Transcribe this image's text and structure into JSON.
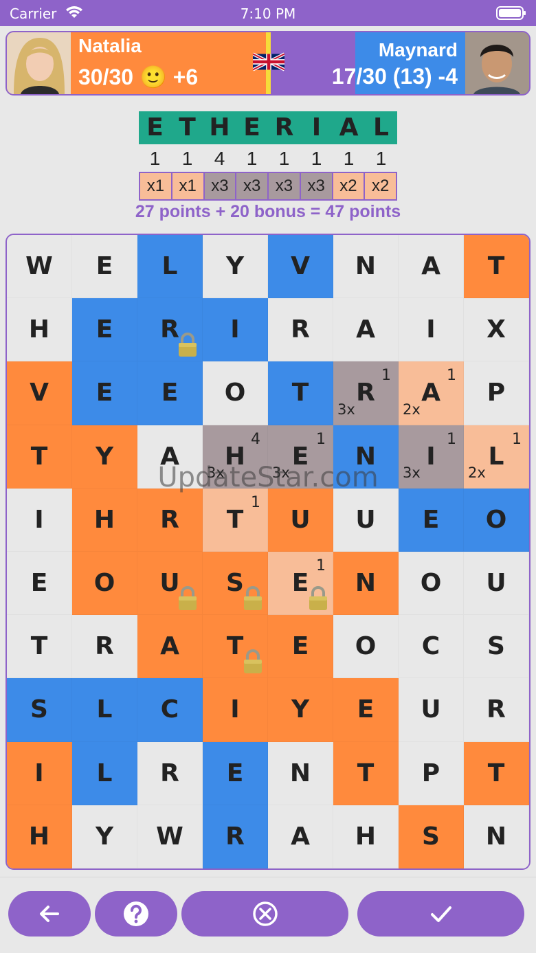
{
  "status": {
    "carrier": "Carrier",
    "time": "7:10 PM"
  },
  "players": {
    "left": {
      "name": "Natalia",
      "score": "30/30 🙂 +6",
      "color": "#ff8a3d"
    },
    "right": {
      "name": "Maynard",
      "score": "17/30 (13) -4",
      "color": "#3d8be8"
    }
  },
  "word": {
    "letters": [
      "E",
      "T",
      "H",
      "E",
      "R",
      "I",
      "A",
      "L"
    ],
    "points": [
      "1",
      "1",
      "4",
      "1",
      "1",
      "1",
      "1",
      "1"
    ],
    "multipliers": [
      "x1",
      "x1",
      "x3",
      "x3",
      "x3",
      "x3",
      "x2",
      "x2"
    ],
    "summary": "27 points + 20 bonus = 47 points"
  },
  "watermark": "UpdateStar.com",
  "board": {
    "rows": [
      [
        {
          "l": "W",
          "c": "n"
        },
        {
          "l": "E",
          "c": "n"
        },
        {
          "l": "L",
          "c": "b"
        },
        {
          "l": "Y",
          "c": "n"
        },
        {
          "l": "V",
          "c": "b"
        },
        {
          "l": "N",
          "c": "n"
        },
        {
          "l": "A",
          "c": "n"
        },
        {
          "l": "T",
          "c": "o"
        }
      ],
      [
        {
          "l": "H",
          "c": "n"
        },
        {
          "l": "E",
          "c": "b"
        },
        {
          "l": "R",
          "c": "b",
          "lock": true
        },
        {
          "l": "I",
          "c": "b"
        },
        {
          "l": "R",
          "c": "n"
        },
        {
          "l": "A",
          "c": "n"
        },
        {
          "l": "I",
          "c": "n"
        },
        {
          "l": "X",
          "c": "n"
        }
      ],
      [
        {
          "l": "V",
          "c": "o"
        },
        {
          "l": "E",
          "c": "b"
        },
        {
          "l": "E",
          "c": "b"
        },
        {
          "l": "O",
          "c": "n"
        },
        {
          "l": "T",
          "c": "b"
        },
        {
          "l": "R",
          "c": "g",
          "pt": "1",
          "mu": "3x"
        },
        {
          "l": "A",
          "c": "p",
          "pt": "1",
          "mu": "2x"
        },
        {
          "l": "P",
          "c": "n"
        }
      ],
      [
        {
          "l": "T",
          "c": "o"
        },
        {
          "l": "Y",
          "c": "o"
        },
        {
          "l": "A",
          "c": "n"
        },
        {
          "l": "H",
          "c": "g",
          "pt": "4",
          "mu": "3x"
        },
        {
          "l": "E",
          "c": "g",
          "pt": "1",
          "mu": "3x"
        },
        {
          "l": "N",
          "c": "b"
        },
        {
          "l": "I",
          "c": "g",
          "pt": "1",
          "mu": "3x"
        },
        {
          "l": "L",
          "c": "p",
          "pt": "1",
          "mu": "2x"
        }
      ],
      [
        {
          "l": "I",
          "c": "n"
        },
        {
          "l": "H",
          "c": "o"
        },
        {
          "l": "R",
          "c": "o"
        },
        {
          "l": "T",
          "c": "p",
          "pt": "1"
        },
        {
          "l": "U",
          "c": "o"
        },
        {
          "l": "U",
          "c": "n"
        },
        {
          "l": "E",
          "c": "b"
        },
        {
          "l": "O",
          "c": "b"
        }
      ],
      [
        {
          "l": "E",
          "c": "n"
        },
        {
          "l": "O",
          "c": "o"
        },
        {
          "l": "U",
          "c": "o",
          "lock": true
        },
        {
          "l": "S",
          "c": "o",
          "lock": true
        },
        {
          "l": "E",
          "c": "p",
          "pt": "1",
          "lock": true
        },
        {
          "l": "N",
          "c": "o"
        },
        {
          "l": "O",
          "c": "n"
        },
        {
          "l": "U",
          "c": "n"
        }
      ],
      [
        {
          "l": "T",
          "c": "n"
        },
        {
          "l": "R",
          "c": "n"
        },
        {
          "l": "A",
          "c": "o"
        },
        {
          "l": "T",
          "c": "o",
          "lock": true
        },
        {
          "l": "E",
          "c": "o"
        },
        {
          "l": "O",
          "c": "n"
        },
        {
          "l": "C",
          "c": "n"
        },
        {
          "l": "S",
          "c": "n"
        }
      ],
      [
        {
          "l": "S",
          "c": "b"
        },
        {
          "l": "L",
          "c": "b"
        },
        {
          "l": "C",
          "c": "b"
        },
        {
          "l": "I",
          "c": "o"
        },
        {
          "l": "Y",
          "c": "o"
        },
        {
          "l": "E",
          "c": "o"
        },
        {
          "l": "U",
          "c": "n"
        },
        {
          "l": "R",
          "c": "n"
        }
      ],
      [
        {
          "l": "I",
          "c": "o"
        },
        {
          "l": "L",
          "c": "b"
        },
        {
          "l": "R",
          "c": "n"
        },
        {
          "l": "E",
          "c": "b"
        },
        {
          "l": "N",
          "c": "n"
        },
        {
          "l": "T",
          "c": "o"
        },
        {
          "l": "P",
          "c": "n"
        },
        {
          "l": "T",
          "c": "o"
        }
      ],
      [
        {
          "l": "H",
          "c": "o"
        },
        {
          "l": "Y",
          "c": "n"
        },
        {
          "l": "W",
          "c": "n"
        },
        {
          "l": "R",
          "c": "b"
        },
        {
          "l": "A",
          "c": "n"
        },
        {
          "l": "H",
          "c": "n"
        },
        {
          "l": "S",
          "c": "o"
        },
        {
          "l": "N",
          "c": "n"
        }
      ]
    ],
    "colors": {
      "n": "#e8e8e8",
      "o": "#ff8a3d",
      "b": "#3d8be8",
      "g": "#a89a9e",
      "p": "#f8bd98"
    }
  },
  "buttons": {
    "back": "arrow-left-icon",
    "help": "question-circle-icon",
    "clear": "x-circle-icon",
    "submit": "checkmark-icon"
  }
}
